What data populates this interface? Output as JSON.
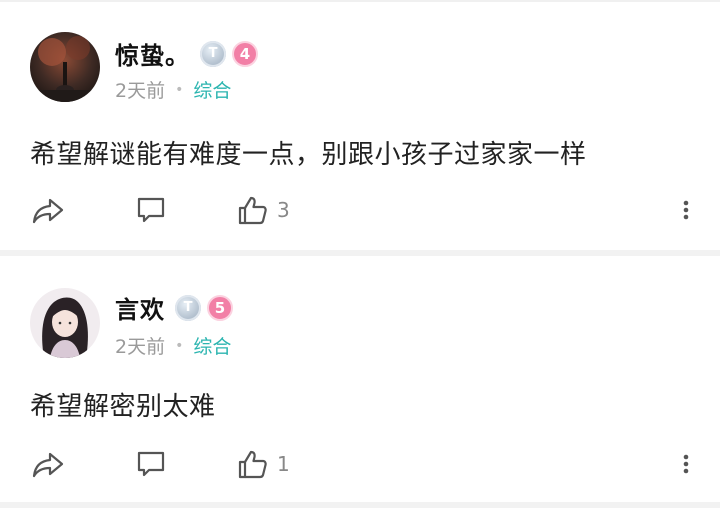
{
  "posts": [
    {
      "username": "惊蛰。",
      "badge_t": "T",
      "level": "4",
      "time": "2天前",
      "separator": "•",
      "category": "综合",
      "content": "希望解谜能有难度一点，别跟小孩子过家家一样",
      "likes": "3",
      "avatar_icon": "dark-forest-avatar"
    },
    {
      "username": "言欢",
      "badge_t": "T",
      "level": "5",
      "time": "2天前",
      "separator": "•",
      "category": "综合",
      "content": "希望解密别太难",
      "likes": "1",
      "avatar_icon": "anime-girl-avatar"
    }
  ],
  "icons": {
    "share": "share-icon",
    "comment": "comment-icon",
    "like": "thumbs-up-icon",
    "more": "more-vertical-icon"
  },
  "colors": {
    "category": "#2cb5b0",
    "level_badge": "#f27fa6",
    "muted": "#9a9a9a"
  }
}
